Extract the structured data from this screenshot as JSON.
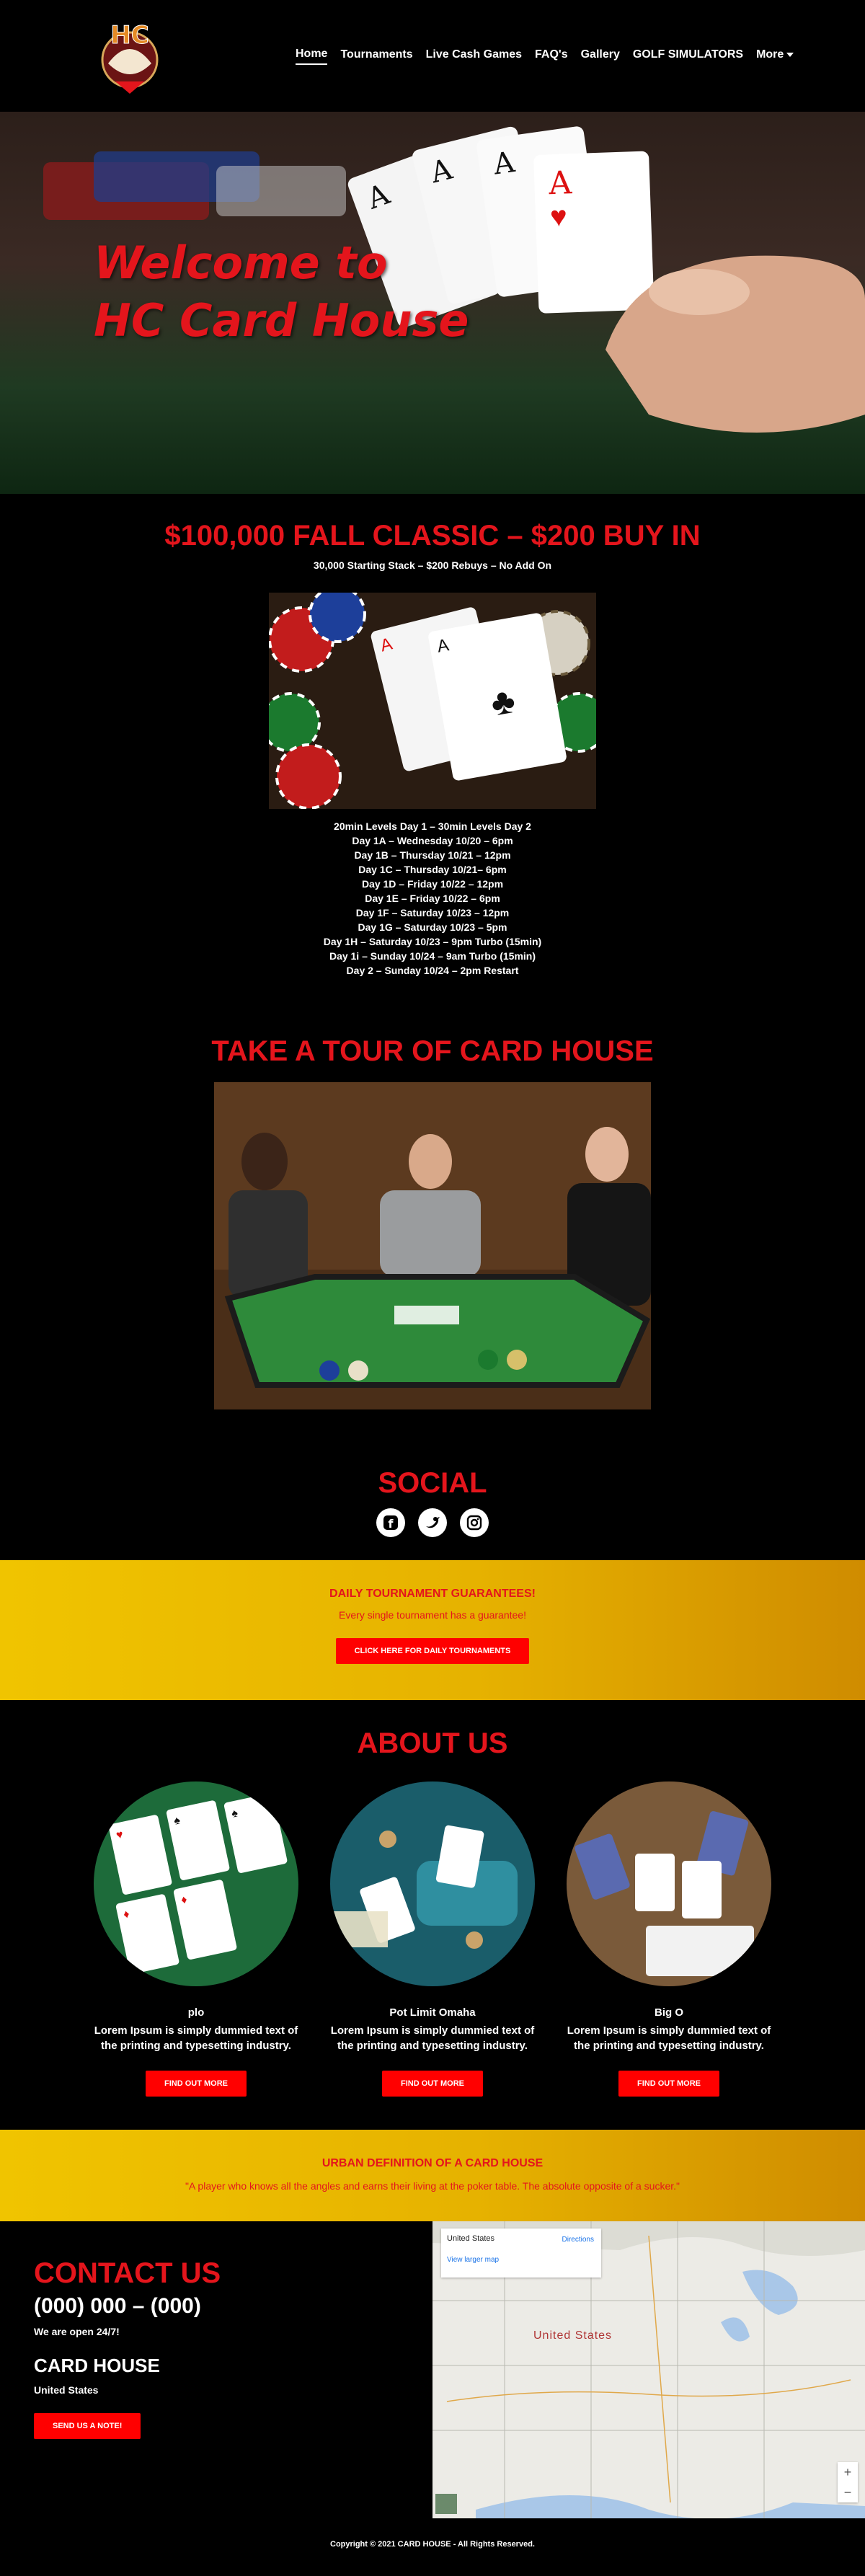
{
  "brand": {
    "logo_text": "HC"
  },
  "nav": {
    "items": [
      {
        "label": "Home",
        "active": true
      },
      {
        "label": "Tournaments"
      },
      {
        "label": "Live Cash Games"
      },
      {
        "label": "FAQ's"
      },
      {
        "label": "Gallery"
      },
      {
        "label": "GOLF SIMULATORS"
      },
      {
        "label": "More"
      }
    ]
  },
  "hero": {
    "line1": "Welcome to",
    "line2": "HC Card House"
  },
  "classic": {
    "title": "$100,000 FALL CLASSIC – $200 BUY IN",
    "subtitle": "30,000 Starting Stack – $200 Rebuys – No Add On",
    "schedule": [
      "20min Levels Day 1 – 30min Levels Day 2",
      "Day 1A – Wednesday 10/20 – 6pm",
      "Day 1B – Thursday 10/21 – 12pm",
      "Day 1C – Thursday 10/21– 6pm",
      "Day 1D – Friday 10/22 – 12pm",
      "Day 1E – Friday 10/22 – 6pm",
      "Day 1F – Saturday 10/23 – 12pm",
      "Day 1G – Saturday 10/23 – 5pm",
      "Day 1H – Saturday 10/23 – 9pm Turbo (15min)",
      "Day 1i – Sunday 10/24 – 9am Turbo (15min)",
      "Day 2 – Sunday 10/24 – 2pm Restart"
    ]
  },
  "tour": {
    "title": "TAKE A TOUR OF CARD HOUSE"
  },
  "social": {
    "title": "SOCIAL",
    "icons": [
      "facebook-icon",
      "twitter-icon",
      "instagram-icon"
    ]
  },
  "banner": {
    "title": "DAILY TOURNAMENT GUARANTEES!",
    "subtitle": "Every single tournament has a guarantee!",
    "button": "CLICK HERE FOR DAILY TOURNAMENTS"
  },
  "about": {
    "title": "ABOUT US",
    "cols": [
      {
        "title": "plo",
        "desc": "Lorem Ipsum is simply dummied text of the printing and typesetting industry.",
        "button": "FIND OUT MORE"
      },
      {
        "title": "Pot Limit Omaha",
        "desc": "Lorem Ipsum is simply dummied text of the printing and typesetting industry.",
        "button": "FIND OUT MORE"
      },
      {
        "title": "Big O",
        "desc": "Lorem Ipsum is simply dummied text of the printing and typesetting industry.",
        "button": "FIND OUT MORE"
      }
    ]
  },
  "definition": {
    "title": "URBAN DEFINITION OF A CARD HOUSE",
    "quote": "\"A player who knows all the angles and earns their living at the poker table. The absolute opposite of a sucker.\""
  },
  "contact": {
    "title": "CONTACT US",
    "phone": "(000) 000 – (000)",
    "hours": "We are open 24/7!",
    "name": "CARD HOUSE",
    "location": "United States",
    "button": "SEND US A NOTE!"
  },
  "map": {
    "card_title": "United States",
    "directions": "Directions",
    "larger": "View larger map",
    "country_label": "United States",
    "zoom_in": "+",
    "zoom_out": "−"
  },
  "footer": {
    "text": "Copyright © 2021 CARD HOUSE - All Rights Reserved."
  },
  "colors": {
    "accent_red": "#e4151c",
    "banner_gold": "#f0c400",
    "button_red": "#ff0000"
  }
}
